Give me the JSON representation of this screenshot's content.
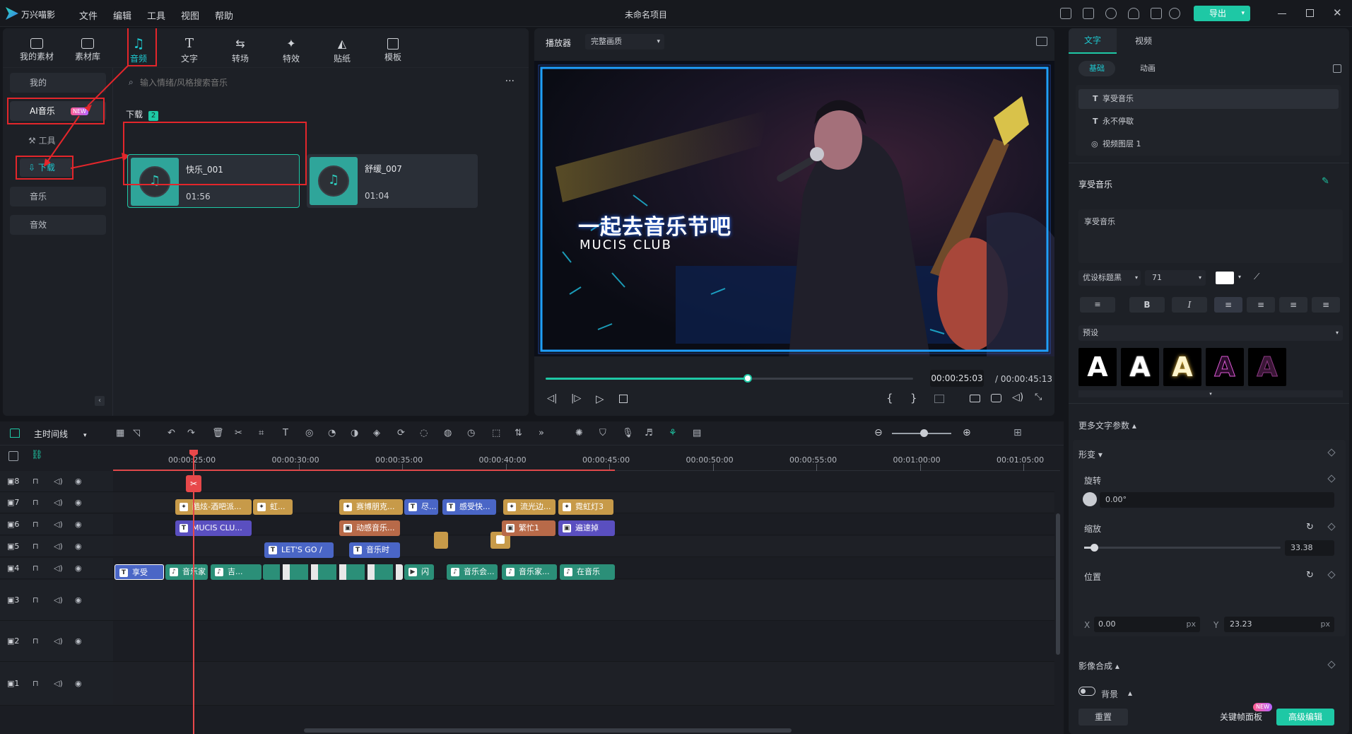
{
  "app": {
    "name": "万兴喵影",
    "project_title": "未命名项目",
    "menu": [
      "文件",
      "编辑",
      "工具",
      "视图",
      "帮助"
    ],
    "export_label": "导出",
    "accent": "#1ec8a5"
  },
  "media_tabs": [
    "我的素材",
    "素材库",
    "音频",
    "文字",
    "转场",
    "特效",
    "贴纸",
    "模板"
  ],
  "media_sidebar": {
    "my": "我的",
    "ai_music": "AI音乐",
    "new_badge": "NEW",
    "tools": "工具",
    "download": "下载",
    "music": "音乐",
    "sfx": "音效"
  },
  "media_search": {
    "placeholder": "输入情绪/风格搜索音乐"
  },
  "download_section": {
    "title": "下载",
    "count": "2",
    "items": [
      {
        "name": "快乐_001",
        "duration": "01:56"
      },
      {
        "name": "舒缓_007",
        "duration": "01:04"
      }
    ]
  },
  "player": {
    "label": "播放器",
    "quality": "完整画质",
    "title_text": "一起去音乐节吧",
    "subtitle_text": "MUCIS CLUB",
    "current_time": "00:00:25:03",
    "total_time": "/ 00:00:45:13",
    "progress": 0.55
  },
  "props": {
    "tabs": [
      "文字",
      "视频"
    ],
    "subtabs": [
      "基础",
      "动画"
    ],
    "layers": [
      "享受音乐",
      "永不停歇",
      "视频图层 1"
    ],
    "section_title": "享受音乐",
    "text_value": "享受音乐",
    "font": "优设标题黑",
    "size": "71",
    "preset_label": "预设",
    "presets": [
      "A",
      "A",
      "A",
      "A",
      "A"
    ],
    "more_params": "更多文字参数",
    "transform": "形变",
    "rotation_label": "旋转",
    "rotation_value": "0.00°",
    "scale_label": "缩放",
    "scale_value": "33.38",
    "scale_level": 0.05,
    "position_label": "位置",
    "pos_x_label": "X",
    "pos_x": "0.00",
    "pos_y_label": "Y",
    "pos_y": "23.23",
    "unit": "px",
    "compositing": "影像合成",
    "background_label": "背景",
    "reset_label": "重置",
    "keyframe_label": "关键帧面板",
    "keyframe_badge": "NEW",
    "advanced_label": "高级编辑"
  },
  "timeline": {
    "label": "主时间线",
    "ruler": [
      "00:00:25:00",
      "00:00:30:00",
      "00:00:35:00",
      "00:00:40:00",
      "00:00:45:00",
      "00:00:50:00",
      "00:00:55:00",
      "00:01:00:00",
      "00:01:05:00"
    ],
    "tracks": [
      "8",
      "7",
      "6",
      "5",
      "4",
      "3",
      "2",
      "1"
    ],
    "clips": {
      "t7": [
        "酷炫-酒吧派...",
        "虹...",
        "赛博朋克...",
        "尽...",
        "感受快...",
        "流光边...",
        "霓虹灯3"
      ],
      "t6": [
        "MUCIS CLU...",
        "动感音乐...",
        "繁忙1",
        "遍速掉"
      ],
      "t5": [
        "LET'S GO /",
        "音乐时"
      ],
      "t4": [
        "享受",
        "音乐家",
        "吉...",
        "闪",
        "音乐会...",
        "音乐家...",
        "在音乐"
      ]
    }
  }
}
